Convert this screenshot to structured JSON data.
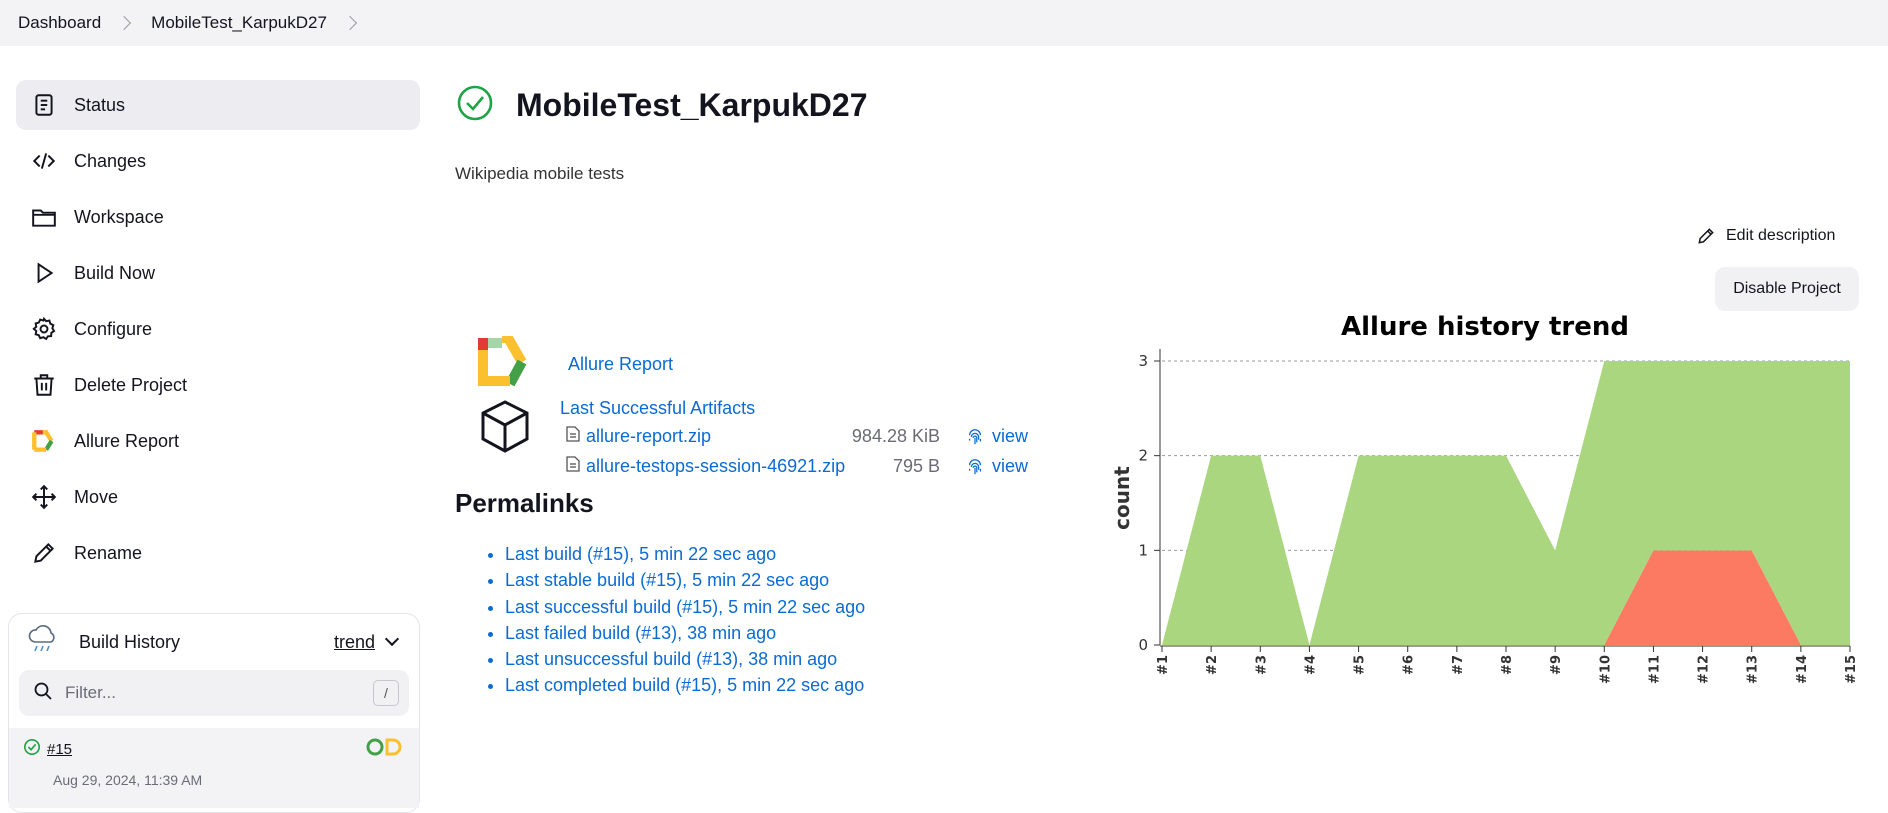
{
  "breadcrumb": [
    "Dashboard",
    "MobileTest_KarpukD27"
  ],
  "sidebar": {
    "items": [
      {
        "label": "Status",
        "icon": "status-document-icon"
      },
      {
        "label": "Changes",
        "icon": "code-icon"
      },
      {
        "label": "Workspace",
        "icon": "folder-icon"
      },
      {
        "label": "Build Now",
        "icon": "play-icon"
      },
      {
        "label": "Configure",
        "icon": "gear-icon"
      },
      {
        "label": "Delete Project",
        "icon": "trash-icon"
      },
      {
        "label": "Allure Report",
        "icon": "allure-logo-icon"
      },
      {
        "label": "Move",
        "icon": "move-arrows-icon"
      },
      {
        "label": "Rename",
        "icon": "pencil-icon"
      }
    ]
  },
  "build_history": {
    "title": "Build History",
    "trend_label": "trend",
    "filter_placeholder": "Filter...",
    "filter_shortcut": "/",
    "builds": [
      {
        "number": "#15",
        "date": "Aug 29, 2024, 11:39 AM"
      }
    ]
  },
  "project": {
    "title": "MobileTest_KarpukD27",
    "description": "Wikipedia mobile tests",
    "edit_description": "Edit description",
    "disable_button": "Disable Project",
    "allure_report_link": "Allure Report",
    "artifacts_title": "Last Successful Artifacts",
    "artifacts": [
      {
        "name": "allure-report.zip",
        "size": "984.28 KiB",
        "action": "view"
      },
      {
        "name": "allure-testops-session-46921.zip",
        "size": "795 B",
        "action": "view"
      }
    ]
  },
  "permalinks": {
    "title": "Permalinks",
    "links": [
      "Last build (#15), 5 min 22 sec ago",
      "Last stable build (#15), 5 min 22 sec ago",
      "Last successful build (#15), 5 min 22 sec ago",
      "Last failed build (#13), 38 min ago",
      "Last unsuccessful build (#13), 38 min ago",
      "Last completed build (#15), 5 min 22 sec ago"
    ]
  },
  "colors": {
    "passed": "#aad67f",
    "failed": "#fc7a62",
    "link": "#0b6bd3",
    "success_icon": "#1ea446"
  },
  "chart_data": {
    "type": "area",
    "title": "Allure history trend",
    "xlabel": "",
    "ylabel": "count",
    "categories": [
      "#1",
      "#2",
      "#3",
      "#4",
      "#5",
      "#6",
      "#7",
      "#8",
      "#9",
      "#10",
      "#11",
      "#12",
      "#13",
      "#14",
      "#15"
    ],
    "series": [
      {
        "values": [
          0,
          0,
          0,
          0,
          0,
          0,
          0,
          0,
          0,
          0,
          1,
          1,
          1,
          0,
          0
        ],
        "color": "#fc7a62"
      },
      {
        "values": [
          0,
          2,
          2,
          0,
          2,
          2,
          2,
          2,
          1,
          3,
          2,
          2,
          2,
          3,
          3
        ],
        "color": "#aad67f"
      }
    ],
    "ylim": [
      0,
      3
    ],
    "yticks": [
      0,
      1,
      2,
      3
    ],
    "grid": "horizontal-dashed",
    "stacked": true
  }
}
